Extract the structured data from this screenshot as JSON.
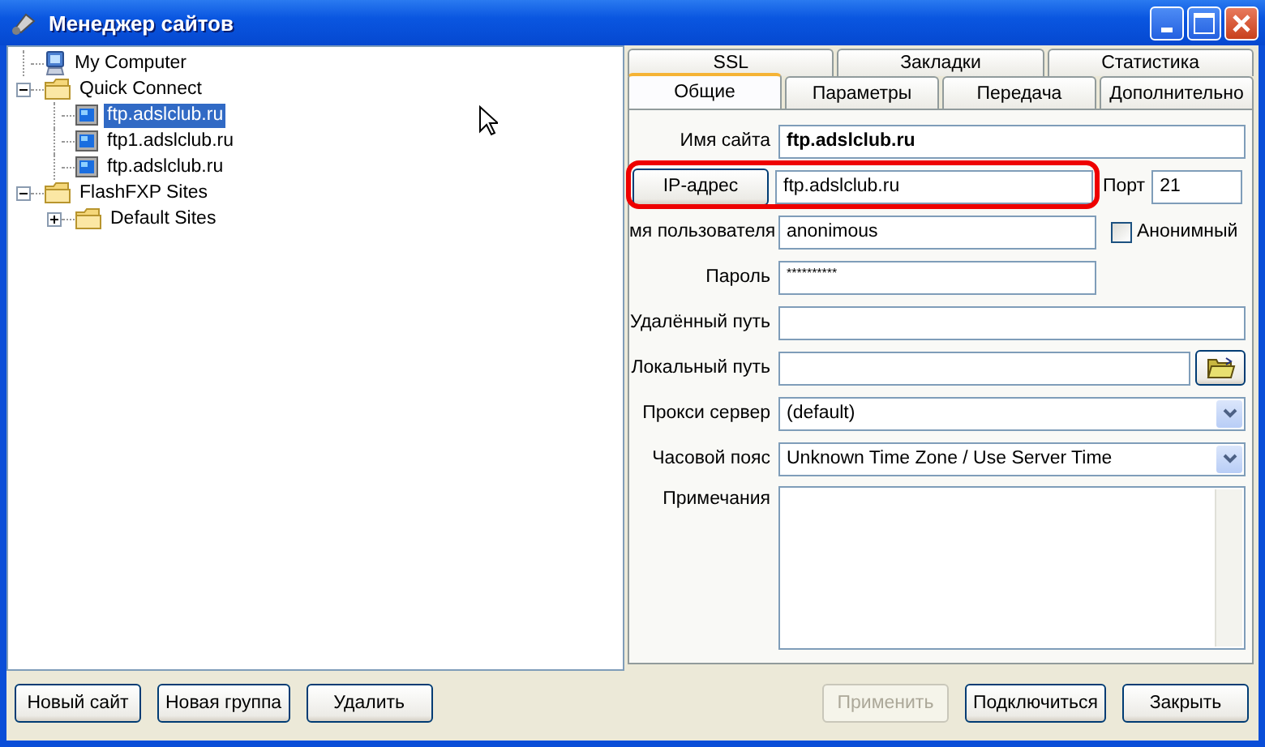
{
  "window": {
    "title": "Менеджер сайтов"
  },
  "tree": [
    {
      "label": "My Computer",
      "kind": "computer",
      "selected": false
    },
    {
      "label": "Quick Connect",
      "kind": "folder",
      "expanded": true,
      "selected": false,
      "children": [
        {
          "label": "ftp.adslclub.ru",
          "kind": "site",
          "selected": true
        },
        {
          "label": "ftp1.adslclub.ru",
          "kind": "site",
          "selected": false
        },
        {
          "label": "ftp.adslclub.ru",
          "kind": "site",
          "selected": false
        }
      ]
    },
    {
      "label": "FlashFXP Sites",
      "kind": "folder",
      "expanded": true,
      "selected": false,
      "children": [
        {
          "label": "Default Sites",
          "kind": "folder",
          "expanded": false,
          "selected": false
        }
      ]
    }
  ],
  "tabs": {
    "back_row": [
      {
        "label": "SSL",
        "selected": false
      },
      {
        "label": "Закладки",
        "selected": false
      },
      {
        "label": "Статистика",
        "selected": false
      }
    ],
    "front_row": [
      {
        "label": "Общие",
        "selected": true
      },
      {
        "label": "Параметры",
        "selected": false
      },
      {
        "label": "Передача",
        "selected": false
      },
      {
        "label": "Дополнительно",
        "selected": false
      }
    ]
  },
  "form": {
    "site_name": {
      "label": "Имя сайта",
      "value": "ftp.adslclub.ru"
    },
    "address": {
      "button": "IP-адрес",
      "value": "ftp.adslclub.ru",
      "highlighted": true
    },
    "port": {
      "label": "Порт",
      "value": "21"
    },
    "username": {
      "label": "мя пользователя",
      "value": "anonimous"
    },
    "anonymous": {
      "label": "Анонимный",
      "checked": false
    },
    "password": {
      "label": "Пароль",
      "value": "**********"
    },
    "remote_path": {
      "label": "Удалённый путь"
    },
    "local_path": {
      "label": "Локальный путь"
    },
    "proxy": {
      "label": "Прокси сервер",
      "value": "(default)"
    },
    "timezone": {
      "label": "Часовой пояс",
      "value": "Unknown Time Zone / Use Server Time"
    },
    "notes": {
      "label": "Примечания"
    }
  },
  "buttons_left": [
    {
      "label": "Новый сайт",
      "disabled": false
    },
    {
      "label": "Новая группа",
      "disabled": false
    },
    {
      "label": "Удалить",
      "disabled": false
    }
  ],
  "buttons_right": [
    {
      "label": "Применить",
      "disabled": true
    },
    {
      "label": "Подключиться",
      "disabled": false
    },
    {
      "label": "Закрыть",
      "disabled": false
    }
  ]
}
